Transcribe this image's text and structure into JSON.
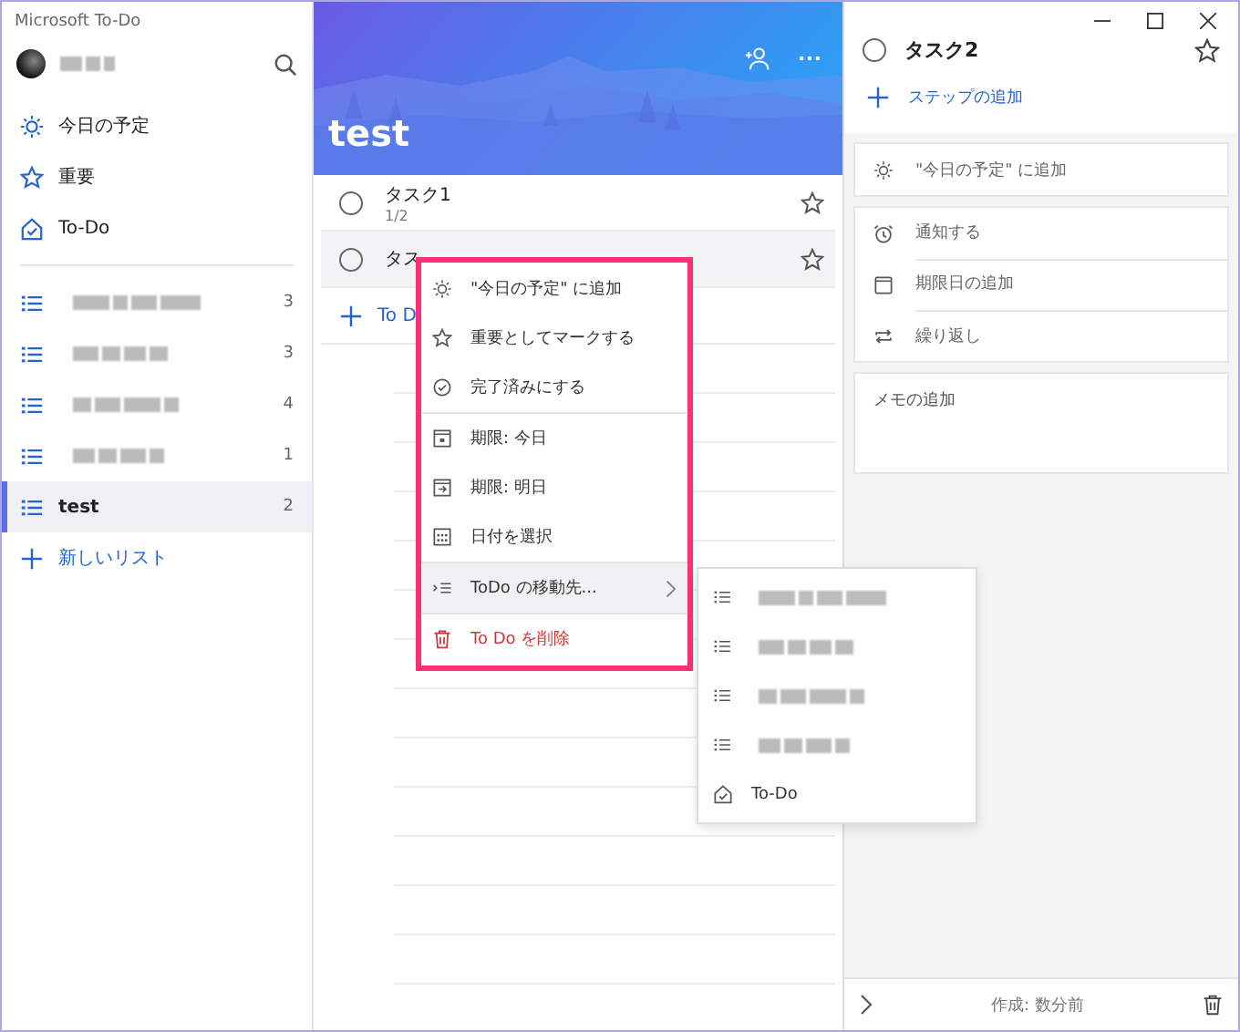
{
  "app_title": "Microsoft To-Do",
  "sidebar": {
    "nav": [
      {
        "kind": "sun",
        "label": "今日の予定"
      },
      {
        "kind": "star",
        "label": "重要"
      },
      {
        "kind": "home",
        "label": "To-Do"
      }
    ],
    "lists": [
      {
        "count": "3",
        "selected": false
      },
      {
        "count": "3",
        "selected": false
      },
      {
        "count": "4",
        "selected": false
      },
      {
        "count": "1",
        "selected": false
      },
      {
        "label": "test",
        "count": "2",
        "selected": true
      }
    ],
    "new_list": "新しいリスト"
  },
  "list": {
    "title": "test",
    "tasks": [
      {
        "title": "タスク1",
        "steps": "1/2",
        "selected": false,
        "completed": false
      },
      {
        "title": "タス",
        "selected": true,
        "completed": false
      }
    ],
    "add_todo": "To D"
  },
  "context_menu": {
    "items": [
      {
        "label": "\"今日の予定\" に追加",
        "kind": "normal",
        "divider_before": false,
        "selected": false
      },
      {
        "label": "重要としてマークする",
        "kind": "normal",
        "divider_before": false,
        "selected": false
      },
      {
        "label": "完了済みにする",
        "kind": "normal",
        "divider_before": false,
        "selected": false
      },
      {
        "label": "期限: 今日",
        "kind": "normal",
        "divider_before": true,
        "selected": false
      },
      {
        "label": "期限: 明日",
        "kind": "normal",
        "divider_before": false,
        "selected": false
      },
      {
        "label": "日付を選択",
        "kind": "normal",
        "divider_before": false,
        "selected": false
      },
      {
        "label": "ToDo の移動先...",
        "kind": "submenu",
        "divider_before": true,
        "selected": true
      },
      {
        "label": "To Do を削除",
        "kind": "danger",
        "divider_before": true,
        "selected": false
      }
    ]
  },
  "submenu": {
    "items": [
      {
        "kind": "list"
      },
      {
        "kind": "list"
      },
      {
        "kind": "list"
      },
      {
        "kind": "list"
      },
      {
        "kind": "home",
        "label": "To-Do"
      }
    ]
  },
  "detail": {
    "title": "タスク2",
    "completed": false,
    "add_step": "ステップの追加",
    "add_today": "\"今日の予定\" に追加",
    "options": [
      {
        "label": "通知する"
      },
      {
        "label": "期限日の追加"
      },
      {
        "label": "繰り返し"
      }
    ],
    "note_placeholder": "メモの追加",
    "created": "作成: 数分前"
  }
}
